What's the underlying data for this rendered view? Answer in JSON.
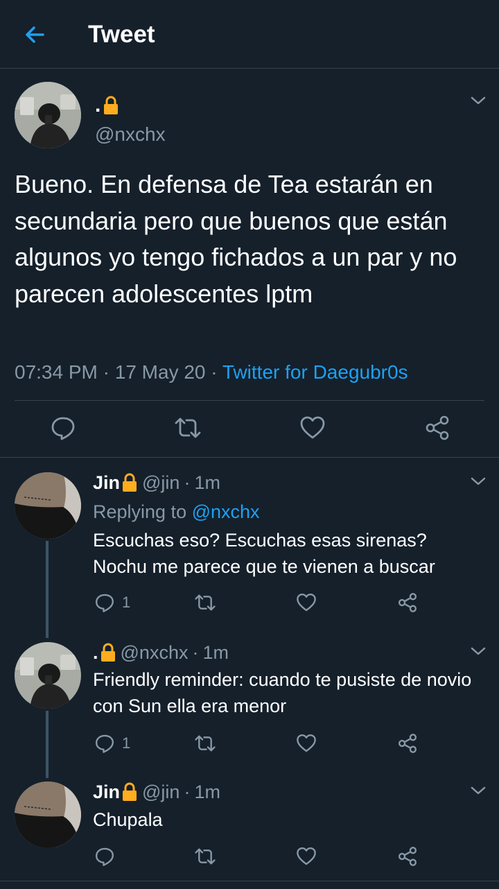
{
  "header": {
    "title": "Tweet"
  },
  "main_tweet": {
    "name": ".",
    "handle": "@nxchx",
    "text": "Bueno. En defensa de Tea estarán en secundaria pero que buenos que están algunos yo tengo fichados a un par y no parecen adolescentes lptm",
    "time": "07:34 PM",
    "date": "17 May 20",
    "source": "Twitter for Daegubr0s",
    "dot_sep": "·"
  },
  "replies": [
    {
      "name": "Jin",
      "handle": "@jin",
      "time_ago": "1m",
      "replying_label": "Replying to",
      "replying_to": "@nxchx",
      "text": "Escuchas eso? Escuchas esas sirenas? Nochu me parece que te vienen a buscar",
      "reply_count": "1"
    },
    {
      "name": ".",
      "handle": "@nxchx",
      "time_ago": "1m",
      "text": "Friendly reminder: cuando te pusiste de novio con Sun ella era menor",
      "reply_count": "1"
    },
    {
      "name": "Jin",
      "handle": "@jin",
      "time_ago": "1m",
      "text": "Chupala"
    }
  ],
  "colors": {
    "background": "#15202b",
    "accent": "#1da1f2",
    "secondary_text": "#8899a6",
    "divider": "#38444d",
    "lock": "#ffad1f"
  },
  "icons": [
    "back-arrow-icon",
    "lock-icon",
    "chevron-down-icon",
    "reply-icon",
    "retweet-icon",
    "like-icon",
    "share-icon"
  ]
}
